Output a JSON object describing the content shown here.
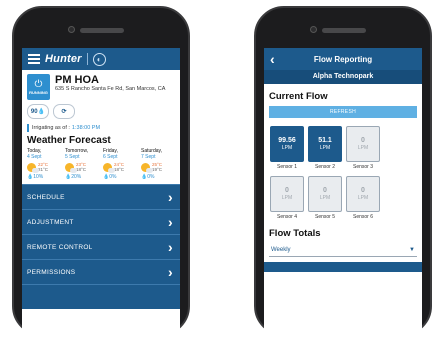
{
  "left_app": {
    "brand": "Hunter",
    "controller": {
      "status": "RUNNING",
      "name": "PM HOA",
      "address": "635 S Rancho Santa Fe Rd, San Marcos, CA"
    },
    "chips": [
      {
        "label": "90"
      },
      {
        "label": "⟳"
      }
    ],
    "irrigating_label": "Irrigating as of :",
    "irrigating_time": "1:38:00 PM",
    "weather_title": "Weather Forecast",
    "forecast": [
      {
        "day": "Today,",
        "date": "4 Sept",
        "hi": "22°C",
        "lo": "21°C",
        "rain": "10%"
      },
      {
        "day": "Tomorrow,",
        "date": "5 Sept",
        "hi": "23°C",
        "lo": "18°C",
        "rain": "20%"
      },
      {
        "day": "Friday,",
        "date": "6 Sept",
        "hi": "24°C",
        "lo": "18°C",
        "rain": "0%"
      },
      {
        "day": "Saturday,",
        "date": "7 Sept",
        "hi": "25°C",
        "lo": "19°C",
        "rain": "0%"
      }
    ],
    "menu": [
      {
        "label": "SCHEDULE"
      },
      {
        "label": "ADJUSTMENT"
      },
      {
        "label": "REMOTE CONTROL"
      },
      {
        "label": "PERMISSIONS"
      }
    ]
  },
  "right_app": {
    "title": "Flow Reporting",
    "subtitle": "Alpha Technopark",
    "current_flow_title": "Current Flow",
    "refresh_label": "REFRESH",
    "sensors": [
      {
        "value": "99.56",
        "unit": "LPM",
        "label": "Sensor 1",
        "active": true
      },
      {
        "value": "51.1",
        "unit": "LPM",
        "label": "Sensor 2",
        "active": true
      },
      {
        "value": "0",
        "unit": "LPM",
        "label": "Sensor 3",
        "active": false
      },
      {
        "value": "0",
        "unit": "LPM",
        "label": "Sensor 4",
        "active": false
      },
      {
        "value": "0",
        "unit": "LPM",
        "label": "Sensor 5",
        "active": false
      },
      {
        "value": "0",
        "unit": "LPM",
        "label": "Sensor 6",
        "active": false
      }
    ],
    "flow_totals_title": "Flow Totals",
    "period_selected": "Weekly"
  },
  "colors": {
    "primary": "#1d5a8c",
    "accent": "#2e8fcf",
    "refresh": "#5fb0e3"
  }
}
